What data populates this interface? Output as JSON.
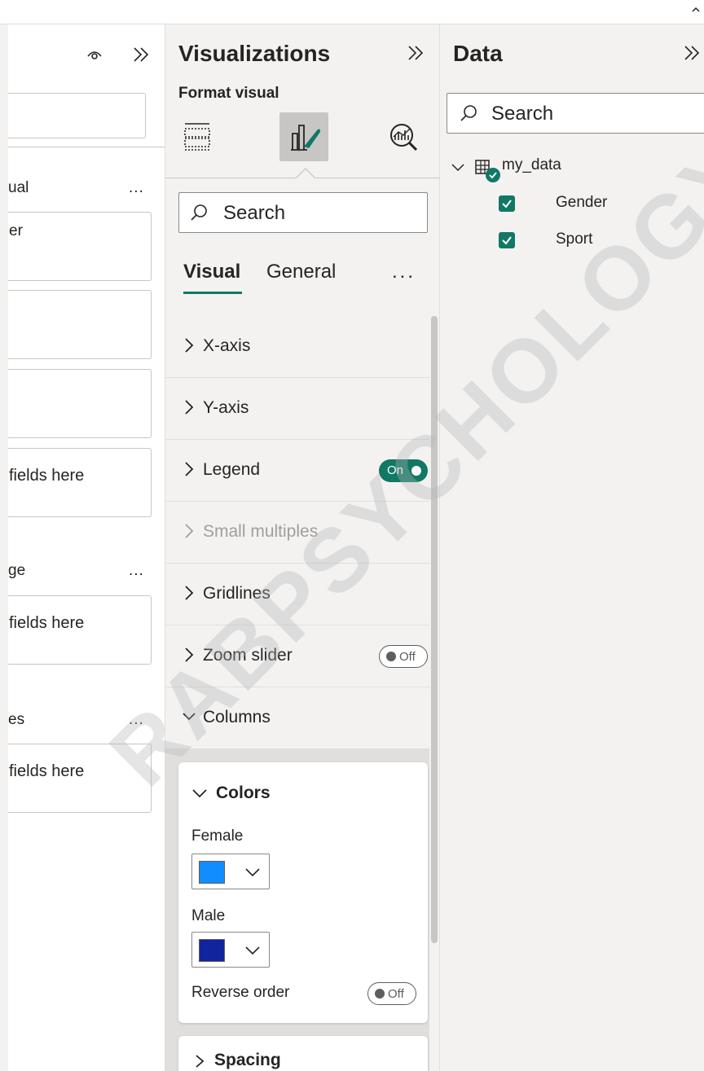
{
  "left_pane": {
    "wells": [
      {
        "label": "ual",
        "box_text": "er"
      },
      {
        "label": "",
        "box_text": ""
      },
      {
        "label": "",
        "box_text": ""
      },
      {
        "label": "",
        "box_text": "fields here"
      },
      {
        "label": "ge",
        "box_text": "fields here"
      },
      {
        "label": "es",
        "box_text": "fields here"
      }
    ],
    "more": "..."
  },
  "viz_pane": {
    "title": "Visualizations",
    "format_label": "Format visual",
    "search_placeholder": "Search",
    "tabs": {
      "visual": "Visual",
      "general": "General",
      "more": "..."
    },
    "sections": [
      {
        "label": "X-axis"
      },
      {
        "label": "Y-axis"
      },
      {
        "label": "Legend",
        "toggle": "On"
      },
      {
        "label": "Small multiples"
      },
      {
        "label": "Gridlines"
      },
      {
        "label": "Zoom slider",
        "toggle": "Off"
      },
      {
        "label": "Columns"
      }
    ],
    "colors_card": {
      "title": "Colors",
      "female_label": "Female",
      "female_color": "#118dff",
      "male_label": "Male",
      "male_color": "#12239e",
      "reverse_label": "Reverse order",
      "reverse_toggle": "Off"
    },
    "spacing_label": "Spacing"
  },
  "data_pane": {
    "title": "Data",
    "search_placeholder": "Search",
    "table_name": "my_data",
    "fields": [
      "Gender",
      "Sport"
    ]
  },
  "watermark": "RABPSYCHOLOGY",
  "colors": {
    "accent": "#117865"
  }
}
